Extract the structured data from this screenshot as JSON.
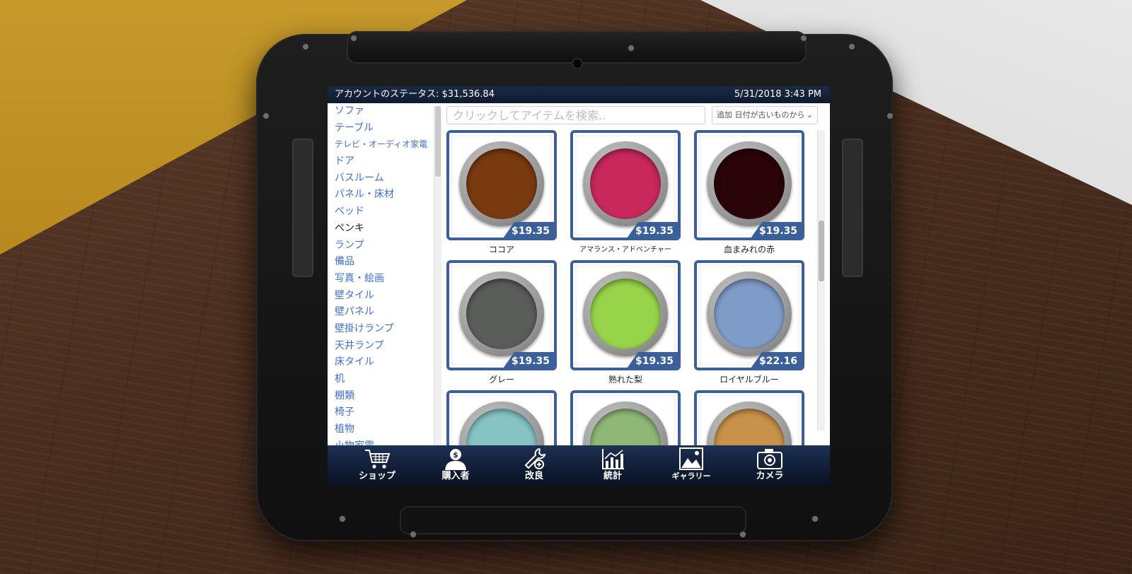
{
  "status": {
    "account_label": "アカウントのステータス:",
    "balance": "$31,536.84",
    "datetime": "5/31/2018 3:43 PM"
  },
  "categories": [
    {
      "label": "ソファ"
    },
    {
      "label": "テーブル"
    },
    {
      "label": "テレビ・オーディオ家電"
    },
    {
      "label": "ドア"
    },
    {
      "label": "バスルーム"
    },
    {
      "label": "パネル・床材"
    },
    {
      "label": "ベッド"
    },
    {
      "label": "ペンキ",
      "active": true
    },
    {
      "label": "ランプ"
    },
    {
      "label": "備品"
    },
    {
      "label": "写真・絵画"
    },
    {
      "label": "壁タイル"
    },
    {
      "label": "壁パネル"
    },
    {
      "label": "壁掛けランプ"
    },
    {
      "label": "天井ランプ"
    },
    {
      "label": "床タイル"
    },
    {
      "label": "机"
    },
    {
      "label": "棚類"
    },
    {
      "label": "椅子"
    },
    {
      "label": "植物"
    },
    {
      "label": "小物家電"
    }
  ],
  "search": {
    "placeholder": "クリックしてアイテムを検索.."
  },
  "sort": {
    "label": "追加 日付が古いものから"
  },
  "items": [
    {
      "name": "ココア",
      "price": "$19.35",
      "color": "#7a3a10"
    },
    {
      "name": "アマランス・アドベンチャー",
      "price": "$19.35",
      "color": "#c8285c"
    },
    {
      "name": "血まみれの赤",
      "price": "$19.35",
      "color": "#2a0408"
    },
    {
      "name": "グレー",
      "price": "$19.35",
      "color": "#5a5d5a"
    },
    {
      "name": "熟れた梨",
      "price": "$19.35",
      "color": "#98d44a"
    },
    {
      "name": "ロイヤルブルー",
      "price": "$22.16",
      "color": "#7f9cc8"
    },
    {
      "name": "",
      "price": "",
      "color": "#86c4c4"
    },
    {
      "name": "",
      "price": "",
      "color": "#8fb878"
    },
    {
      "name": "",
      "price": "",
      "color": "#c8924a"
    }
  ],
  "dock": [
    {
      "label": "ショップ",
      "icon": "shopping-cart-icon"
    },
    {
      "label": "購入者",
      "icon": "buyer-person-icon"
    },
    {
      "label": "改良",
      "icon": "wrench-icon"
    },
    {
      "label": "統計",
      "icon": "chart-icon"
    },
    {
      "label": "ギャラリー",
      "icon": "gallery-icon"
    },
    {
      "label": "カメラ",
      "icon": "camera-icon"
    }
  ]
}
